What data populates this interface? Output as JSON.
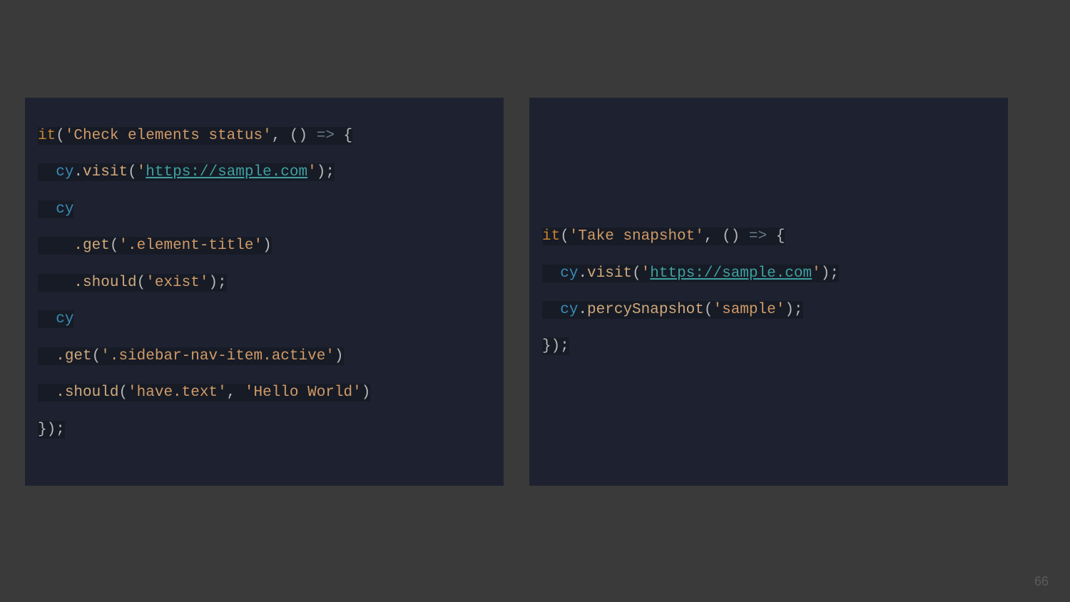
{
  "page_number": "66",
  "left": {
    "l1_it": "it",
    "l1_paren1": "(",
    "l1_str": "'Check elements status'",
    "l1_comma": ", ",
    "l1_parens": "()",
    "l1_arrow": " => ",
    "l1_brace": "{",
    "l2_cy": "  cy",
    "l2_dot": ".",
    "l2_visit": "visit",
    "l2_open": "(",
    "l2_q1": "'",
    "l2_url": "https://sample.com",
    "l2_q2": "'",
    "l2_close": ");",
    "l3_cy": "  cy",
    "l4_get": "    .get",
    "l4_open": "(",
    "l4_str": "'.element-title'",
    "l4_close": ")",
    "l5_should": "    .should",
    "l5_open": "(",
    "l5_str": "'exist'",
    "l5_close": ");",
    "l6_cy": "  cy",
    "l7_get": "  .get",
    "l7_open": "(",
    "l7_str": "'.sidebar-nav-item.active'",
    "l7_close": ")",
    "l8_should": "  .should",
    "l8_open": "(",
    "l8_str1": "'have.text'",
    "l8_comma": ", ",
    "l8_str2": "'Hello World'",
    "l8_close": ")",
    "l9_close": "});"
  },
  "right": {
    "l1_it": "it",
    "l1_paren1": "(",
    "l1_str": "'Take snapshot'",
    "l1_comma": ", ",
    "l1_parens": "()",
    "l1_arrow": " => ",
    "l1_brace": "{",
    "l2_cy": "  cy",
    "l2_dot": ".",
    "l2_visit": "visit",
    "l2_open": "(",
    "l2_q1": "'",
    "l2_url": "https://sample.com",
    "l2_q2": "'",
    "l2_close": ");",
    "l3_cy": "  cy",
    "l3_dot": ".",
    "l3_method": "percySnapshot",
    "l3_open": "(",
    "l3_str": "'sample'",
    "l3_close": ");",
    "l4_close": "});"
  }
}
